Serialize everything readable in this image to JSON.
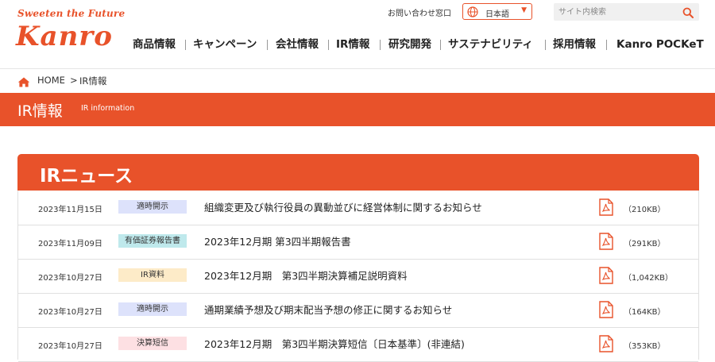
{
  "brand": {
    "tagline": "Sweeten the Future",
    "name": "Kanro"
  },
  "topbar": {
    "contact_label": "お問い合わせ窓口",
    "language_label": "日本語",
    "search_placeholder": "サイト内検索"
  },
  "nav": {
    "items": [
      {
        "label": "商品情報"
      },
      {
        "label": "キャンペーン"
      },
      {
        "label": "会社情報"
      },
      {
        "label": "IR情報"
      },
      {
        "label": "研究開発"
      },
      {
        "label": "サステナビリティ"
      },
      {
        "label": "採用情報"
      },
      {
        "label": "Kanro POCKeT"
      }
    ]
  },
  "breadcrumb": {
    "home": "HOME",
    "separator": ">",
    "current": "IR情報"
  },
  "banner": {
    "title": "IR情報",
    "subtitle": "IR information"
  },
  "news": {
    "heading": "IRニュース",
    "rows": [
      {
        "date": "2023年11月15日",
        "category": "適時開示",
        "title": "組織変更及び執行役員の異動並びに経営体制に関するお知らせ",
        "size": "（210KB）"
      },
      {
        "date": "2023年11月09日",
        "category": "有価証券報告書",
        "title": "2023年12月期 第3四半期報告書",
        "size": "（291KB）"
      },
      {
        "date": "2023年10月27日",
        "category": "IR資料",
        "title": "2023年12月期　第3四半期決算補足説明資料",
        "size": "（1,042KB）"
      },
      {
        "date": "2023年10月27日",
        "category": "適時開示",
        "title": "通期業績予想及び期末配当予想の修正に関するお知らせ",
        "size": "（164KB）"
      },
      {
        "date": "2023年10月27日",
        "category": "決算短信",
        "title": "2023年12月期　第3四半期決算短信〔日本基準〕(非連結)",
        "size": "（353KB）"
      }
    ]
  },
  "colors": {
    "brand_orange": "#e8522a",
    "badge_timely": "#dde2fb",
    "badge_securities": "#bfe9ec",
    "badge_ir": "#fdebc8",
    "badge_results": "#fde0e3"
  }
}
